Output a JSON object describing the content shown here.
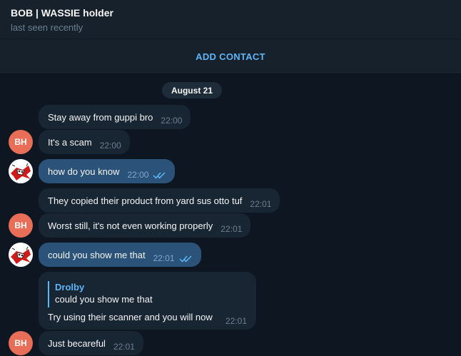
{
  "header": {
    "title": "BOB | WASSIE holder",
    "status": "last seen recently"
  },
  "add_contact": {
    "label": "ADD CONTACT"
  },
  "date_separator": "August 21",
  "avatars": {
    "bob_initials": "BH"
  },
  "messages": [
    {
      "text": "Stay away from guppi bro",
      "time": "22:00",
      "direction": "incoming"
    },
    {
      "text": "It's a scam",
      "time": "22:00",
      "direction": "incoming"
    },
    {
      "text": "how do you know",
      "time": "22:00",
      "direction": "outgoing",
      "status": "read"
    },
    {
      "text": "They copied their product from yard sus otto tuf",
      "time": "22:01",
      "direction": "incoming"
    },
    {
      "text": "Worst still, it's not even working properly",
      "time": "22:01",
      "direction": "incoming"
    },
    {
      "text": "could you show me that",
      "time": "22:01",
      "direction": "outgoing",
      "status": "read"
    },
    {
      "reply_to": {
        "author": "Drolby",
        "text": "could you show me that"
      },
      "text": "Try using their scanner and you will now",
      "time": "22:01",
      "direction": "incoming"
    },
    {
      "text": "Just becareful",
      "time": "22:01",
      "direction": "incoming"
    }
  ],
  "colors": {
    "background": "#0e1621",
    "header": "#17212b",
    "incoming_bubble": "#182533",
    "outgoing_bubble": "#2b5278",
    "accent": "#5eb5f7",
    "avatar_bh": "#e86e58"
  }
}
